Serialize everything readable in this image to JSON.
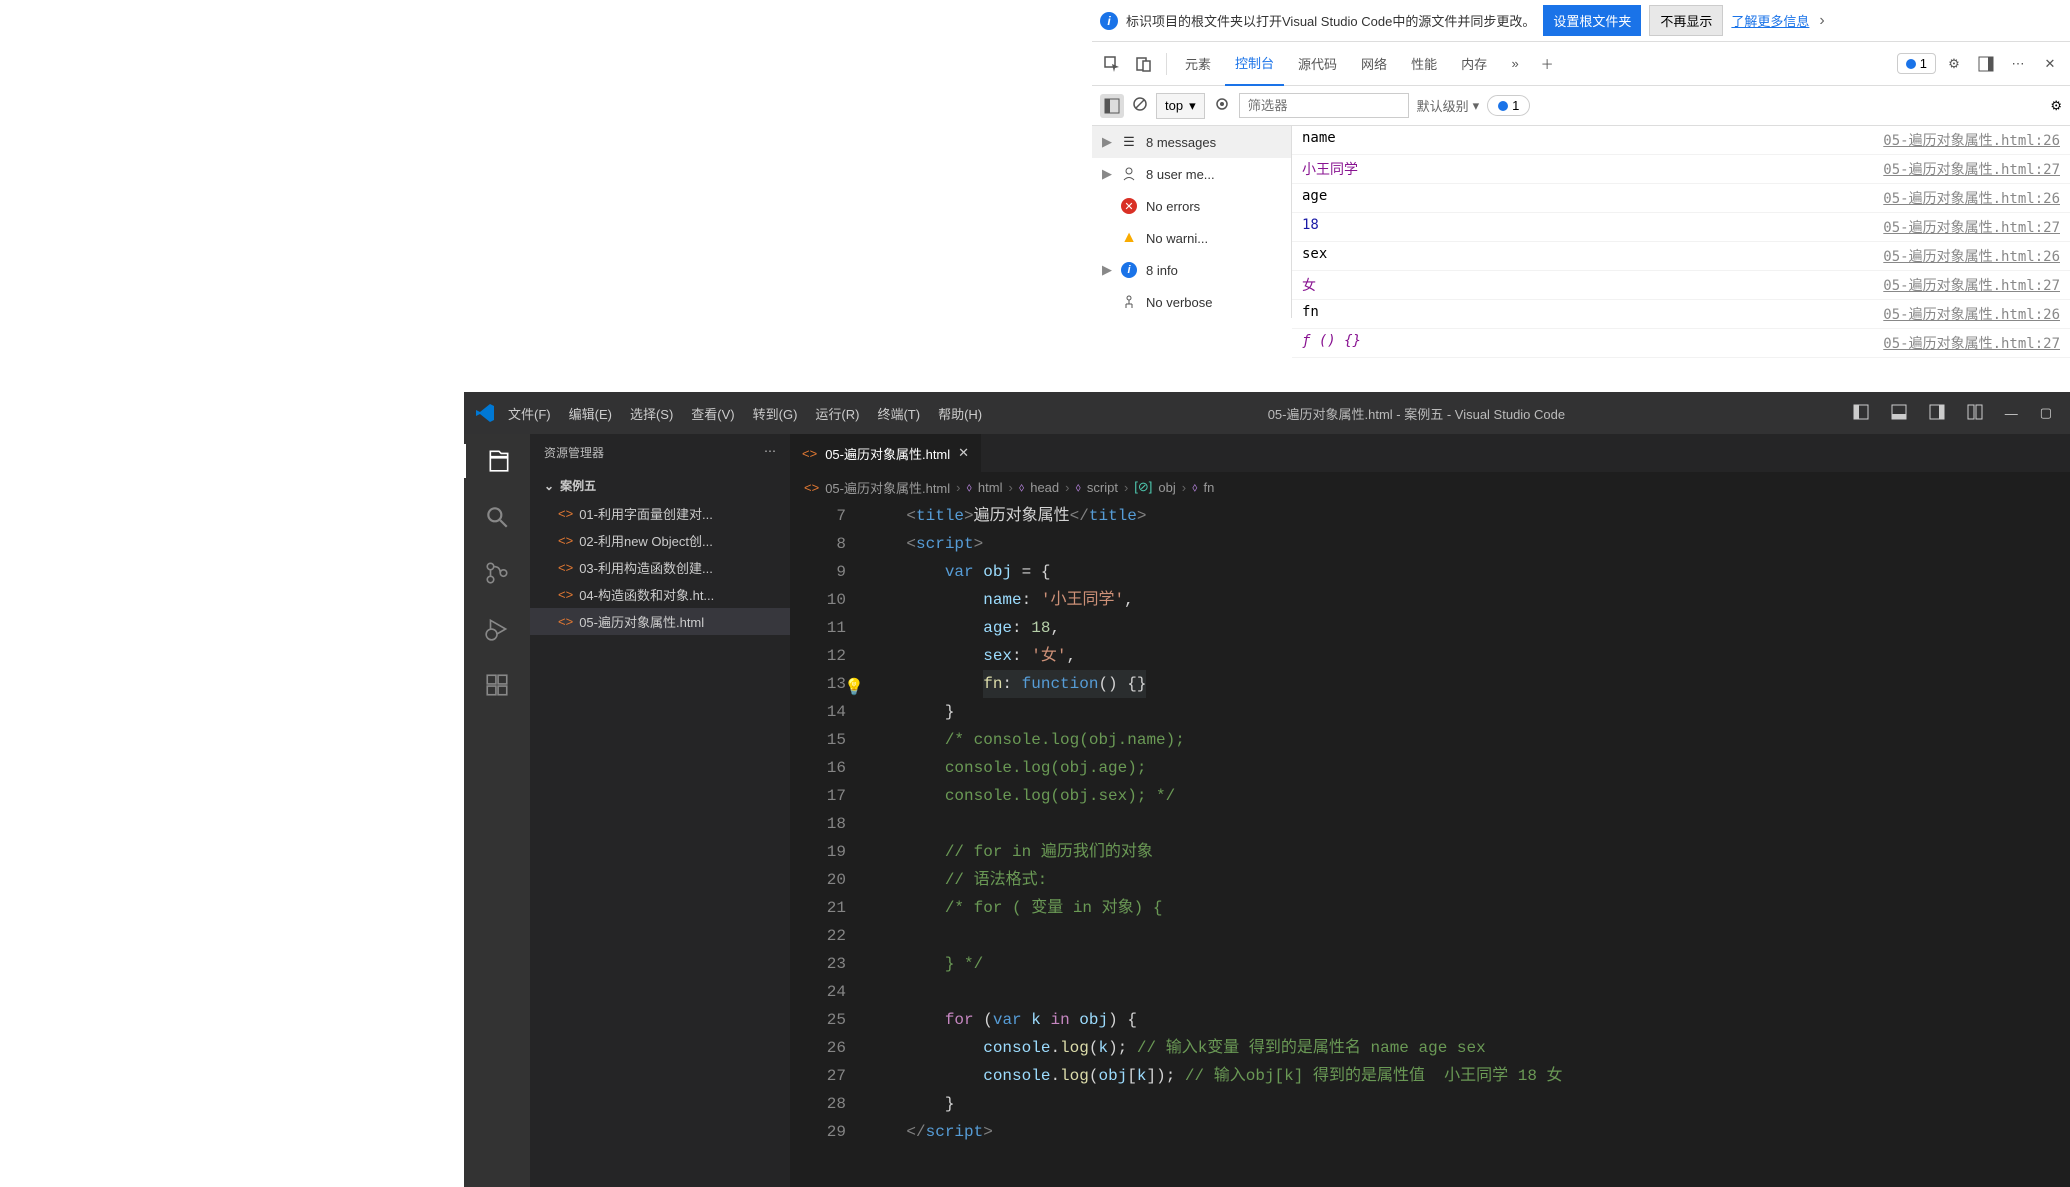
{
  "notif": {
    "text": "标识项目的根文件夹以打开Visual Studio Code中的源文件并同步更改。",
    "btn_set": "设置根文件夹",
    "btn_hide": "不再显示",
    "link_more": "了解更多信息"
  },
  "devtools": {
    "tabs": {
      "elements": "元素",
      "console": "控制台",
      "sources": "源代码",
      "network": "网络",
      "performance": "性能",
      "memory": "内存"
    },
    "issues_count": "1",
    "console_toolbar": {
      "context": "top",
      "filter_placeholder": "筛选器",
      "level": "默认级别",
      "badge_count": "1"
    },
    "sidebar": {
      "messages": "8 messages",
      "user": "8 user me...",
      "errors": "No errors",
      "warnings": "No warni...",
      "info": "8 info",
      "verbose": "No verbose"
    },
    "output": [
      {
        "val": "name",
        "cls": "",
        "src": "05-遍历对象属性.html:26"
      },
      {
        "val": "小王同学",
        "cls": "val-purple",
        "src": "05-遍历对象属性.html:27"
      },
      {
        "val": "age",
        "cls": "",
        "src": "05-遍历对象属性.html:26"
      },
      {
        "val": "18",
        "cls": "val-blue",
        "src": "05-遍历对象属性.html:27"
      },
      {
        "val": "sex",
        "cls": "",
        "src": "05-遍历对象属性.html:26"
      },
      {
        "val": "女",
        "cls": "val-purple",
        "src": "05-遍历对象属性.html:27"
      },
      {
        "val": "fn",
        "cls": "",
        "src": "05-遍历对象属性.html:26"
      },
      {
        "val": "ƒ () {}",
        "cls": "val-fn",
        "src": "05-遍历对象属性.html:27"
      }
    ]
  },
  "vscode": {
    "title_center": "05-遍历对象属性.html - 案例五 - Visual Studio Code",
    "menu": {
      "file": "文件(F)",
      "edit": "编辑(E)",
      "select": "选择(S)",
      "view": "查看(V)",
      "goto": "转到(G)",
      "run": "运行(R)",
      "terminal": "终端(T)",
      "help": "帮助(H)"
    },
    "explorer": {
      "header": "资源管理器",
      "project": "案例五",
      "files": [
        "01-利用字面量创建对...",
        "02-利用new Object创...",
        "03-利用构造函数创建...",
        "04-构造函数和对象.ht...",
        "05-遍历对象属性.html"
      ],
      "active_index": 4
    },
    "tab": {
      "name": "05-遍历对象属性.html"
    },
    "breadcrumb": {
      "file": "05-遍历对象属性.html",
      "p1": "html",
      "p2": "head",
      "p3": "script",
      "p4": "obj",
      "p5": "fn"
    },
    "lines": {
      "start": 7,
      "count": 23,
      "bulb_line": 13,
      "title_text": "遍历对象属性",
      "name_val": "'小王同学'",
      "age_val": "18",
      "sex_val": "'女'",
      "cm1": "/* console.log(obj.name);",
      "cm2": "console.log(obj.age);",
      "cm3": "console.log(obj.sex); */",
      "cm4": "// for in 遍历我们的对象",
      "cm5": "// 语法格式:",
      "cm6": "/* for ( 变量 in 对象) {",
      "cm7": "} */",
      "cm8": "// 输入k变量 得到的是属性名 name age sex",
      "cm9": "// 输入obj[k] 得到的是属性值  小王同学 18 女"
    }
  }
}
